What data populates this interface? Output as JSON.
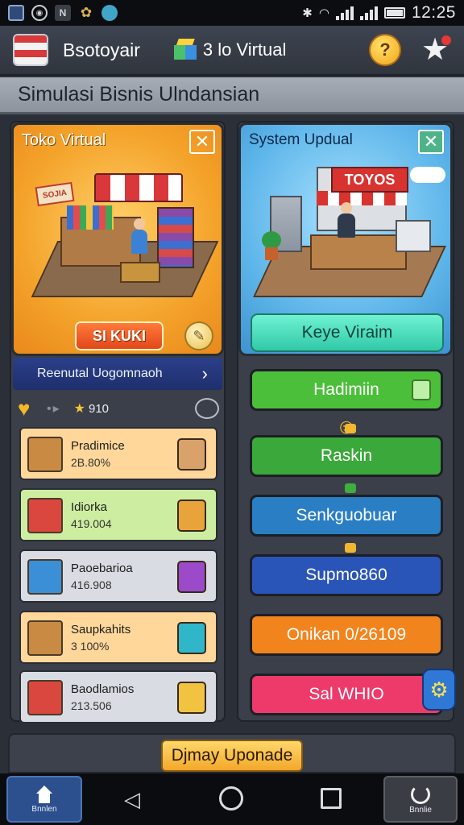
{
  "status_bar": {
    "time": "12:25",
    "icons": [
      "gallery-icon",
      "sync-icon",
      "n-icon",
      "gear-icon",
      "globe-icon",
      "bluetooth-icon",
      "wifi-icon",
      "signal-icon",
      "battery-icon"
    ]
  },
  "header": {
    "app_name": "Bsotoyair",
    "mode_label": "3 lo Virtual"
  },
  "page_title": "Simulasi Bisnis Ulndansian",
  "left_card": {
    "title": "Toko Virtual",
    "sign_text": "SOJIA",
    "button_label": "SI KUKI"
  },
  "right_card": {
    "title": "System Updual",
    "sign_text": "TOYOS",
    "button_label": "Keye Viraim"
  },
  "subnav": {
    "label": "Reenutal Uogomnaoh",
    "chevron": "›"
  },
  "stats": {
    "coins": "910"
  },
  "items": [
    {
      "name": "Pradimice",
      "value": "2B.80%",
      "bg": "#ffd79a",
      "icon_color": "#c98a43",
      "badge_color": "#d9a26a"
    },
    {
      "name": "Idiorka",
      "value": "419.004",
      "bg": "#cdeea0",
      "icon_color": "#d9473f",
      "badge_color": "#e8a43a"
    },
    {
      "name": "Paoebarioa",
      "value": "416.908",
      "bg": "#d9dce2",
      "icon_color": "#3a8fd6",
      "badge_color": "#9b4ac9"
    },
    {
      "name": "Saupkahits",
      "value": "3 100%",
      "bg": "#ffd79a",
      "icon_color": "#c98a43",
      "badge_color": "#2fb7c9"
    },
    {
      "name": "Baodlamios",
      "value": "213.506",
      "bg": "#d9dce2",
      "icon_color": "#d9473f",
      "badge_color": "#f2c341"
    }
  ],
  "right_buttons": [
    {
      "label": "Hadimiin",
      "color": "#4cbf3a"
    },
    {
      "label": "Raskin",
      "color": "#3aa83a"
    },
    {
      "label": "Senkguobuar",
      "color": "#2a7ec4"
    },
    {
      "label": "Supmo860",
      "color": "#2a55b8"
    },
    {
      "label": "Onikan 0/26109",
      "color": "#f2841e"
    },
    {
      "label": "Sal WHIO",
      "color": "#ee3a6a"
    }
  ],
  "upgrade": {
    "label": "Djmay Uponade"
  },
  "nav": {
    "home_label": "Bnnlen",
    "recent_label": "Bnnlie"
  },
  "colors": {
    "accent_orange": "#f4a32a",
    "accent_blue": "#5fb6ea",
    "teal_button": "#31c9a8"
  }
}
